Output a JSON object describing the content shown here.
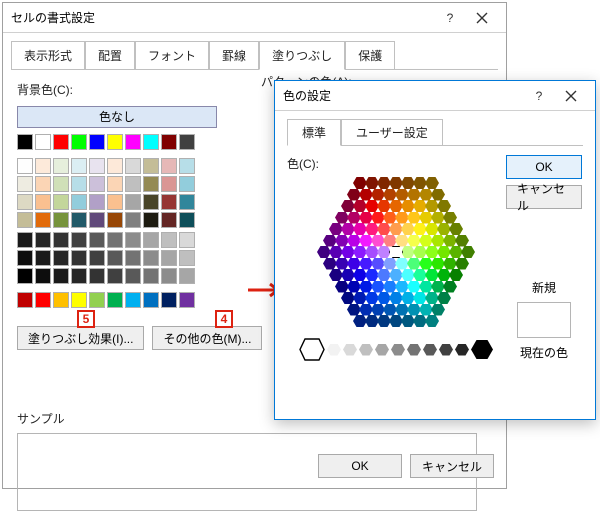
{
  "mainDialog": {
    "title": "セルの書式設定",
    "tabs": [
      "表示形式",
      "配置",
      "フォント",
      "罫線",
      "塗りつぶし",
      "保護"
    ],
    "activeTab": 4,
    "bgColorLabel": "背景色(C):",
    "noColor": "色なし",
    "patternColorLabel": "パターンの色(A):",
    "fillEffects": "塗りつぶし効果(I)...",
    "moreColors": "その他の色(M)...",
    "sampleLabel": "サンプル",
    "ok": "OK",
    "cancel": "キャンセル",
    "palette": {
      "topRow": [
        "#000000",
        "#ffffff",
        "#ff0000",
        "#00ff00",
        "#0000ff",
        "#ffff00",
        "#ff00ff",
        "#00ffff",
        "#800000",
        "#404040"
      ],
      "pastelRows": [
        [
          "#fefefe",
          "#fdeada",
          "#e6efdc",
          "#dbeef3",
          "#e8e3ef",
          "#fde9d9",
          "#d9d9d9",
          "#c4bd97",
          "#e6b8b7",
          "#b7dee8"
        ],
        [
          "#eeece1",
          "#fbd5b5",
          "#d0e0b8",
          "#b7dee8",
          "#ccc0da",
          "#fbd5b5",
          "#bfbfbf",
          "#948a54",
          "#da9694",
          "#92cddc"
        ],
        [
          "#ddd9c3",
          "#fac090",
          "#c3d69b",
          "#92cddc",
          "#b1a0c7",
          "#fac08f",
          "#a6a6a6",
          "#494529",
          "#963634",
          "#31869b"
        ],
        [
          "#c4bd97",
          "#e26b0a",
          "#76933c",
          "#215967",
          "#60497a",
          "#974706",
          "#808080",
          "#1d1b10",
          "#632523",
          "#0e4f5a"
        ]
      ],
      "darkRows": [
        [
          "#1a1a1a",
          "#262626",
          "#333333",
          "#404040",
          "#595959",
          "#737373",
          "#8c8c8c",
          "#a6a6a6",
          "#bfbfbf",
          "#d9d9d9"
        ],
        [
          "#0d0d0d",
          "#1a1a1a",
          "#262626",
          "#333333",
          "#404040",
          "#595959",
          "#737373",
          "#8c8c8c",
          "#a6a6a6",
          "#bfbfbf"
        ],
        [
          "#000000",
          "#0d0d0d",
          "#1a1a1a",
          "#262626",
          "#333333",
          "#404040",
          "#595959",
          "#737373",
          "#8c8c8c",
          "#a6a6a6"
        ]
      ],
      "accentRow": [
        "#c00000",
        "#ff0000",
        "#ffc000",
        "#ffff00",
        "#92d050",
        "#00b050",
        "#00b0f0",
        "#0070c0",
        "#002060",
        "#7030a0"
      ]
    }
  },
  "colorDialog": {
    "title": "色の設定",
    "tabs": [
      "標準",
      "ユーザー設定"
    ],
    "activeTab": 0,
    "colorsLabel": "色(C):",
    "ok": "OK",
    "cancel": "キャンセル",
    "newLabel": "新規",
    "currentLabel": "現在の色",
    "grayscale": [
      "#ffffff",
      "#f2f2f2",
      "#d9d9d9",
      "#bfbfbf",
      "#a6a6a6",
      "#8c8c8c",
      "#737373",
      "#595959",
      "#404040",
      "#262626",
      "#000000"
    ]
  },
  "callouts": {
    "c4": "4",
    "c5": "5"
  }
}
